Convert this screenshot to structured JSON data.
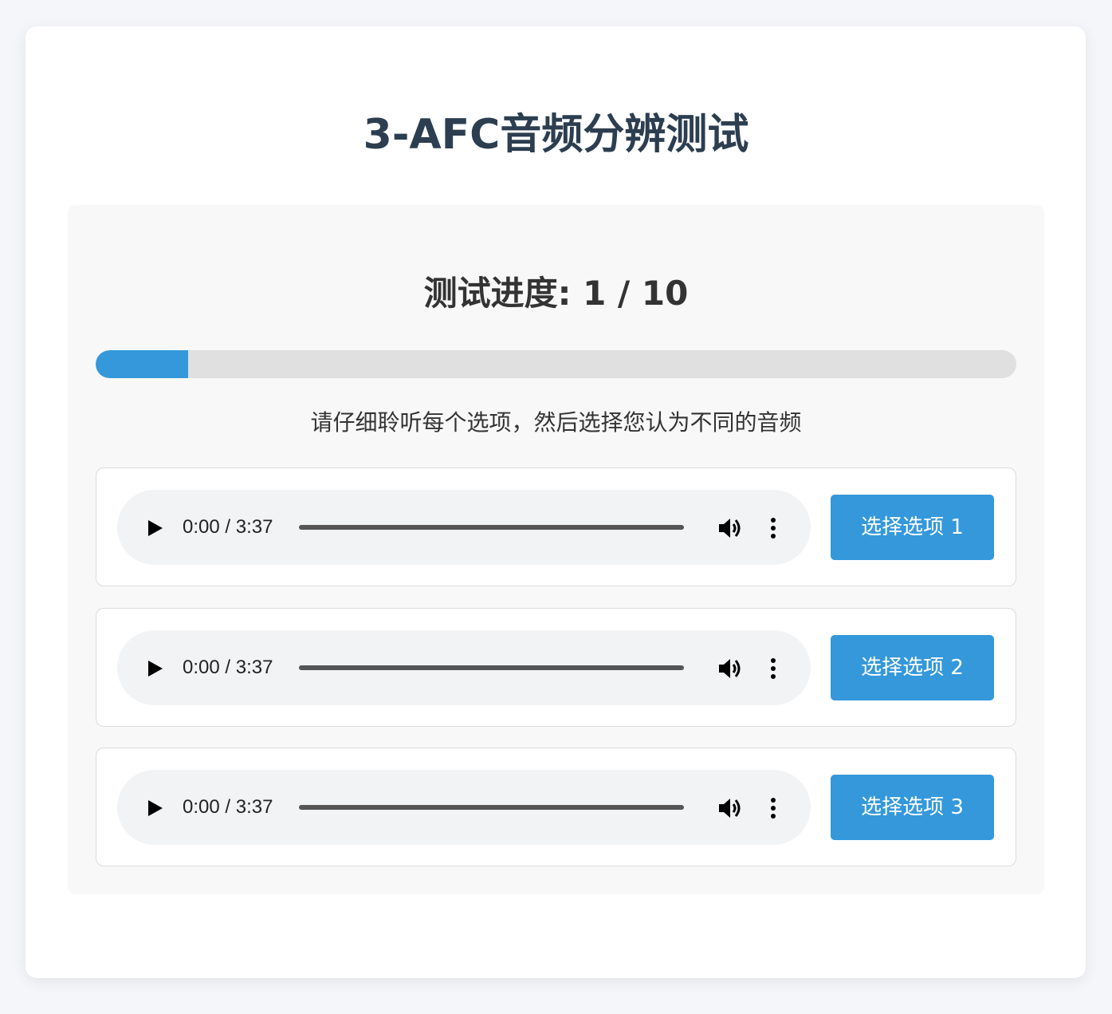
{
  "title": "3-AFC音频分辨测试",
  "progress": {
    "label": "测试进度: 1 / 10",
    "current": 1,
    "total": 10
  },
  "instructions": "请仔细聆听每个选项，然后选择您认为不同的音频",
  "options": [
    {
      "time": "0:00 / 3:37",
      "button_label": "选择选项 1"
    },
    {
      "time": "0:00 / 3:37",
      "button_label": "选择选项 2"
    },
    {
      "time": "0:00 / 3:37",
      "button_label": "选择选项 3"
    }
  ],
  "colors": {
    "accent": "#3498db",
    "title": "#2c3e50",
    "track": "#e0e0e0",
    "player_bg": "#f1f3f4"
  },
  "icons": [
    "play-icon",
    "volume-icon",
    "more-vertical-icon"
  ]
}
